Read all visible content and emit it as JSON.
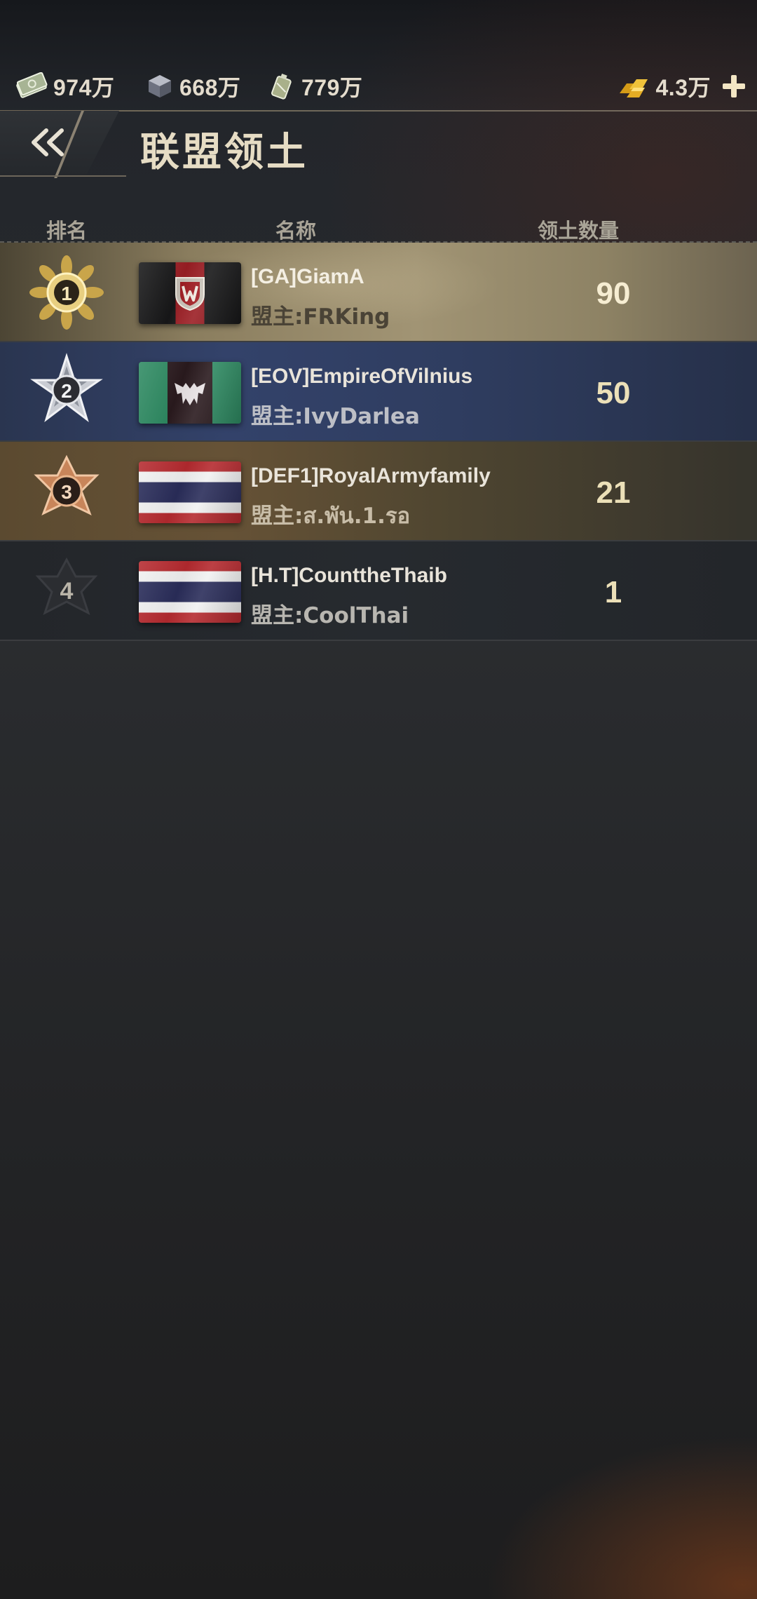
{
  "resources": {
    "money": {
      "icon": "cash-stack-icon",
      "amount": "974万"
    },
    "steel": {
      "icon": "steel-ingot-icon",
      "amount": "668万"
    },
    "oil": {
      "icon": "oil-canister-icon",
      "amount": "779万"
    },
    "gold": {
      "icon": "gold-bars-icon",
      "amount": "4.3万"
    }
  },
  "header": {
    "title": "联盟领土",
    "back_icon": "double-chevron-left-icon"
  },
  "columns": {
    "rank": "排名",
    "name": "名称",
    "territory": "领土数量"
  },
  "leader_label": "盟主:",
  "rankings": [
    {
      "rank": "1",
      "medal": "gold-medal-icon",
      "name": "[GA]GiamA",
      "leader": "FRKing",
      "territory": "90",
      "flag": "red-black-w-banner"
    },
    {
      "rank": "2",
      "medal": "silver-medal-icon",
      "name": "[EOV]EmpireOfVilnius",
      "leader": "IvyDarlea",
      "territory": "50",
      "flag": "green-black-emblem-banner"
    },
    {
      "rank": "3",
      "medal": "bronze-medal-icon",
      "name": "[DEF1]RoyalArmyfamily",
      "leader": "ส.พัน.1.รอ",
      "territory": "21",
      "flag": "thai-flag"
    },
    {
      "rank": "4",
      "medal": "dark-star-badge-icon",
      "name": "[H.T]CounttheThaib",
      "leader": "CoolThai",
      "territory": "1",
      "flag": "thai-flag"
    }
  ],
  "colors": {
    "gold_row": "#a19474",
    "silver_row": "#33426a",
    "bronze_row": "#665236",
    "accent_text": "#ece0b8"
  }
}
